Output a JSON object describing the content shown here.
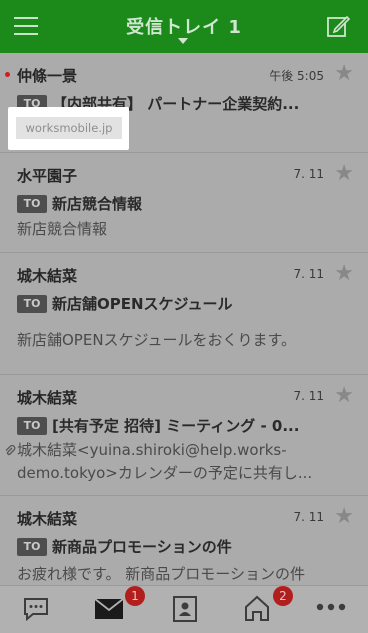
{
  "header": {
    "title": "受信トレイ 1",
    "menu_icon": "hamburger-menu-icon",
    "compose_icon": "compose-icon"
  },
  "tooltip": {
    "text": "worksmobile.jp"
  },
  "mails": [
    {
      "sender": "仲條一景",
      "date": "午後 5:05",
      "badge": "TO",
      "subject": "【内部共有】 パートナー企業契約...",
      "preview": "",
      "unread": true
    },
    {
      "sender": "水平園子",
      "date": "7. 11",
      "badge": "TO",
      "subject": "新店競合情報",
      "preview": "新店競合情報"
    },
    {
      "sender": "城木結菜",
      "date": "7. 11",
      "badge": "TO",
      "subject": "新店舗OPENスケジュール",
      "preview": "新店舗OPENスケジュールをおくります。"
    },
    {
      "sender": "城木結菜",
      "date": "7. 11",
      "badge": "TO",
      "subject": "[共有予定 招待] ミーティング - 0...",
      "preview_line1": "城木結菜<yuina.shiroki@help.works-",
      "preview_line2": "demo.tokyo>カレンダーの予定に共有し...",
      "attachment": true
    },
    {
      "sender": "城木結菜",
      "date": "7. 11",
      "badge": "TO",
      "subject": "新商品プロモーションの件",
      "preview": "お疲れ様です。 新商品プロモーションの件"
    }
  ],
  "tabbar": {
    "items": [
      {
        "name": "talk",
        "icon": "chat-icon"
      },
      {
        "name": "mail",
        "icon": "mail-icon",
        "badge": "1"
      },
      {
        "name": "contacts",
        "icon": "contacts-icon"
      },
      {
        "name": "home",
        "icon": "home-icon",
        "badge": "2"
      },
      {
        "name": "more",
        "icon": "more-icon"
      }
    ]
  },
  "colors": {
    "header": "#1b8a1b",
    "overlay": "#ababab",
    "badge": "#b21e1e",
    "unread": "#d11d1d"
  }
}
